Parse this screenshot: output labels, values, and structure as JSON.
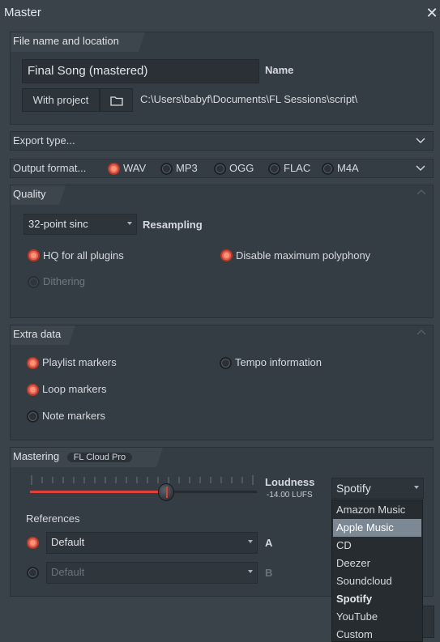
{
  "window": {
    "title": "Master",
    "close_glyph": "✕"
  },
  "file": {
    "heading": "File name and location",
    "filename": "Final Song (mastered)",
    "name_label": "Name",
    "with_project": "With project",
    "path": "C:\\Users\\babyf\\Documents\\FL Sessions\\script\\"
  },
  "export_type": {
    "label": "Export type..."
  },
  "output_format": {
    "label": "Output format...",
    "options": [
      {
        "label": "WAV",
        "checked": true
      },
      {
        "label": "MP3",
        "checked": false
      },
      {
        "label": "OGG",
        "checked": false
      },
      {
        "label": "FLAC",
        "checked": false
      },
      {
        "label": "M4A",
        "checked": false
      }
    ]
  },
  "quality": {
    "heading": "Quality",
    "resampler": "32-point sinc",
    "resampling_label": "Resampling",
    "hq_plugins": "HQ for all plugins",
    "disable_polyphony": "Disable maximum polyphony",
    "dithering": "Dithering"
  },
  "extra_data": {
    "heading": "Extra data",
    "playlist_markers": "Playlist markers",
    "tempo_information": "Tempo information",
    "loop_markers": "Loop markers",
    "note_markers": "Note markers"
  },
  "mastering": {
    "heading": "Mastering",
    "badge": "FL Cloud Pro",
    "loudness_label": "Loudness",
    "loudness_value": "-14.00 LUFS",
    "slider_fraction": 0.6,
    "target": "Spotify",
    "references_label": "References",
    "reference_a": "Default",
    "reference_a_tag": "A",
    "reference_b": "Default",
    "reference_b_tag": "B"
  },
  "target_dropdown": {
    "options": [
      "Amazon Music",
      "Apple Music",
      "CD",
      "Deezer",
      "Soundcloud",
      "Spotify",
      "YouTube",
      "Custom"
    ],
    "highlighted": "Apple Music",
    "selected": "Spotify"
  },
  "colors": {
    "accent": "#ff8f78",
    "background": "#3a4349",
    "panel": "#343d43"
  }
}
